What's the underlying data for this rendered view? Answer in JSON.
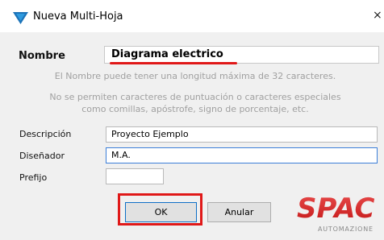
{
  "window": {
    "title": "Nueva Multi-Hoja",
    "close_symbol": "×",
    "icon": "down-triangle-logo-icon"
  },
  "form": {
    "nombre_label": "Nombre",
    "nombre_value": "Diagrama electrico",
    "hint_line1": "El Nombre puede tener una longitud máxima de 32 caracteres.",
    "hint_line2": "No se permiten caracteres de puntuación o caracteres especiales",
    "hint_line3": "como comillas, apóstrofe, signo de porcentaje, etc.",
    "descripcion_label": "Descripción",
    "descripcion_value": "Proyecto Ejemplo",
    "disenador_label": "Diseñador",
    "disenador_value": "M.A.",
    "prefijo_label": "Prefijo",
    "prefijo_value": ""
  },
  "buttons": {
    "ok": "OK",
    "anular": "Anular"
  },
  "logo": {
    "brand": "SPAC",
    "tagline": "AUTOMAZIONE"
  },
  "colors": {
    "accent_red": "#e01818",
    "focus_blue": "#3c7fd8",
    "icon_blue": "#1c73b8"
  }
}
